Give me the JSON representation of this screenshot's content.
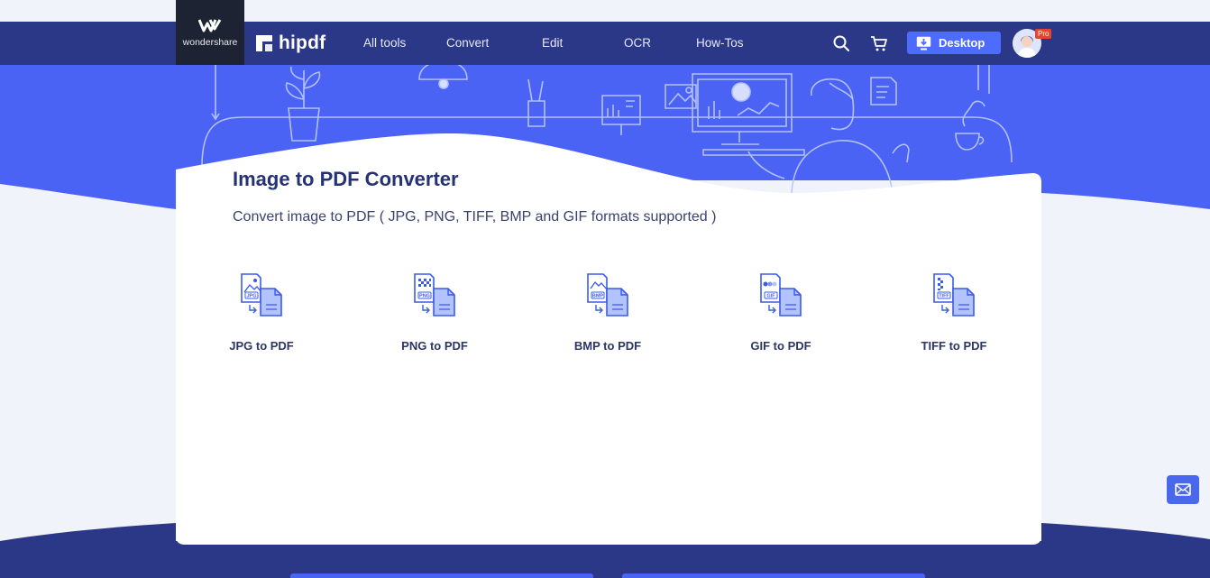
{
  "brand": {
    "company": "wondershare",
    "product": "hipdf"
  },
  "nav": {
    "items": [
      {
        "label": "All tools"
      },
      {
        "label": "Convert"
      },
      {
        "label": "Edit"
      },
      {
        "label": "OCR"
      },
      {
        "label": "How-Tos"
      }
    ],
    "desktop_label": "Desktop",
    "pro_badge": "Pro"
  },
  "main": {
    "title": "Image to PDF Converter",
    "subtitle": "Convert image to PDF ( JPG, PNG, TIFF, BMP and GIF formats supported )",
    "tools": [
      {
        "label": "JPG to PDF",
        "badge": "JPG"
      },
      {
        "label": "PNG to PDF",
        "badge": "PNG"
      },
      {
        "label": "BMP to PDF",
        "badge": "BMP"
      },
      {
        "label": "GIF to PDF",
        "badge": "GIF"
      },
      {
        "label": "TIFF to PDF",
        "badge": "TIFF"
      }
    ]
  },
  "colors": {
    "nav": "#2b3787",
    "hero": "#4b63f5",
    "accent": "#4d6cff",
    "title": "#253374"
  },
  "icons": [
    "wondershare-logo",
    "hipdf-logo",
    "search-icon",
    "cart-icon",
    "desktop-download-icon",
    "avatar",
    "mail-icon"
  ]
}
